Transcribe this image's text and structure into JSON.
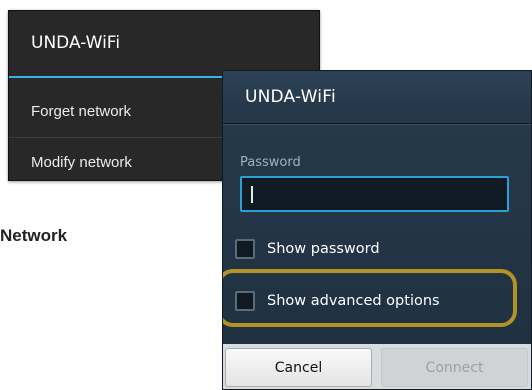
{
  "context_menu": {
    "title": "UNDA-WiFi",
    "items": [
      {
        "label": "Forget network"
      },
      {
        "label": "Modify network"
      }
    ],
    "accent_color": "#33b5e5"
  },
  "side_heading": "Network",
  "dialog": {
    "title": "UNDA-WiFi",
    "password_label": "Password",
    "password_value": "",
    "checkboxes": [
      {
        "label": "Show password",
        "checked": false
      },
      {
        "label": "Show advanced options",
        "checked": false,
        "highlighted": true
      }
    ],
    "buttons": {
      "cancel": "Cancel",
      "connect": "Connect",
      "connect_enabled": false
    },
    "highlight_color": "#b39226"
  }
}
